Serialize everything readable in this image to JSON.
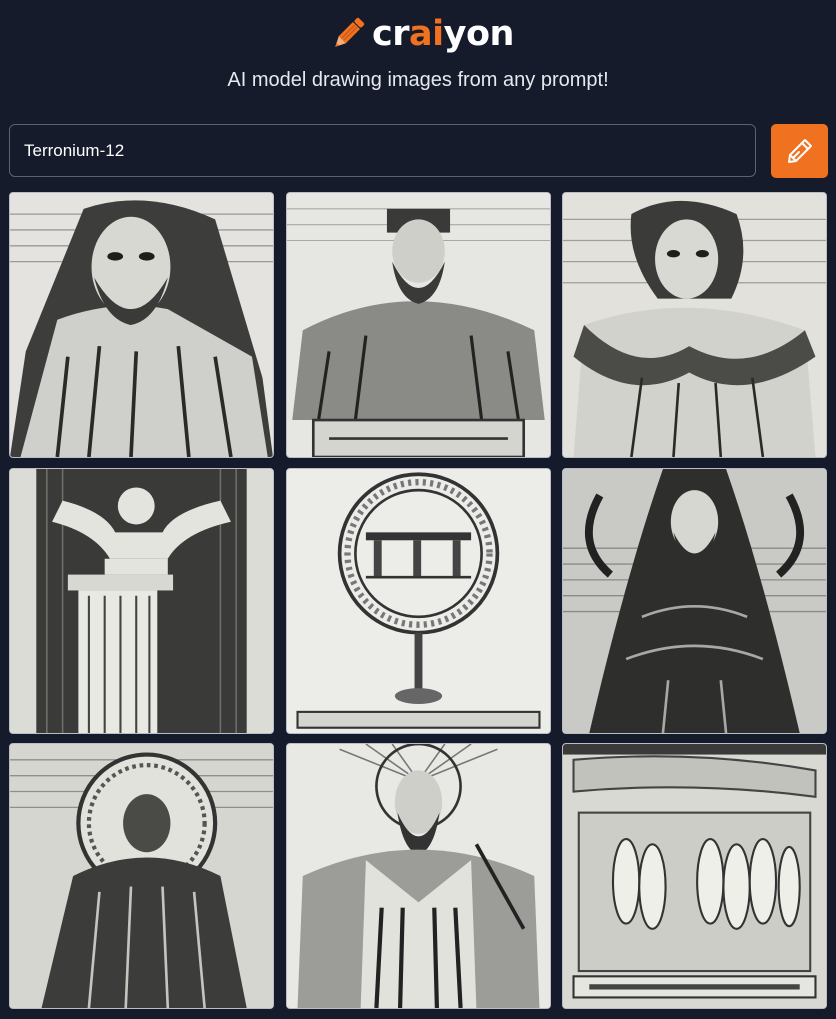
{
  "header": {
    "logo": {
      "icon": "pencil-icon",
      "text_before": "cr",
      "text_accent": "ai",
      "text_after": "yon"
    },
    "tagline": "AI model drawing images from any prompt!"
  },
  "prompt": {
    "value": "Terronium-12"
  },
  "draw_button": {
    "icon": "pencil-icon"
  },
  "colors": {
    "background": "#151b2b",
    "accent": "#f0711f",
    "input_border": "#5b6275",
    "text": "#ffffff"
  },
  "results": {
    "images": [
      {
        "subject": "bearded hooded figure engraving"
      },
      {
        "subject": "crowned king with scroll engraving"
      },
      {
        "subject": "curly-haired figure in cloak engraving"
      },
      {
        "subject": "statue on column engraving"
      },
      {
        "subject": "circular seal emblem engraving"
      },
      {
        "subject": "hooded robed figure engraving"
      },
      {
        "subject": "haloed saint engraving"
      },
      {
        "subject": "bearded saint with halo engraving"
      },
      {
        "subject": "relief of standing figures engraving"
      }
    ]
  }
}
